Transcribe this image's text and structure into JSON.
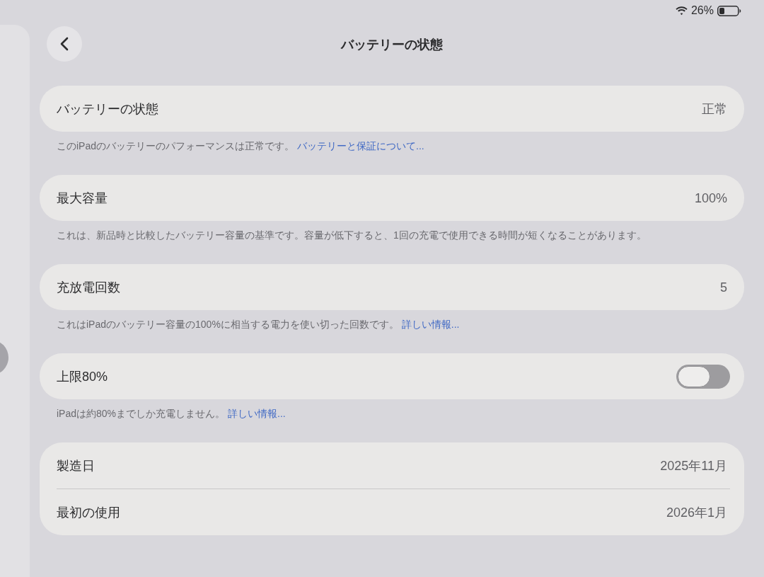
{
  "status_bar": {
    "battery_percent": "26%"
  },
  "navigation": {
    "title": "バッテリーの状態"
  },
  "sections": [
    {
      "rows": [
        {
          "kind": "value",
          "label": "バッテリーの状態",
          "value": "正常"
        }
      ],
      "footer": {
        "text": "このiPadのバッテリーのパフォーマンスは正常です。",
        "link": "バッテリーと保証について..."
      }
    },
    {
      "rows": [
        {
          "kind": "value",
          "label": "最大容量",
          "value": "100%"
        }
      ],
      "footer": {
        "text": "これは、新品時と比較したバッテリー容量の基準です。容量が低下すると、1回の充電で使用できる時間が短くなることがあります。"
      }
    },
    {
      "rows": [
        {
          "kind": "value",
          "label": "充放電回数",
          "value": "5"
        }
      ],
      "footer": {
        "text": "これはiPadのバッテリー容量の100%に相当する電力を使い切った回数です。",
        "link": "詳しい情報..."
      }
    },
    {
      "rows": [
        {
          "kind": "toggle",
          "label": "上限80%",
          "on": false
        }
      ],
      "footer": {
        "text": "iPadは約80%までしか充電しません。",
        "link": "詳しい情報..."
      }
    },
    {
      "rows": [
        {
          "kind": "value",
          "label": "製造日",
          "value": "2025年11月"
        },
        {
          "kind": "value",
          "label": "最初の使用",
          "value": "2026年1月"
        }
      ]
    }
  ]
}
